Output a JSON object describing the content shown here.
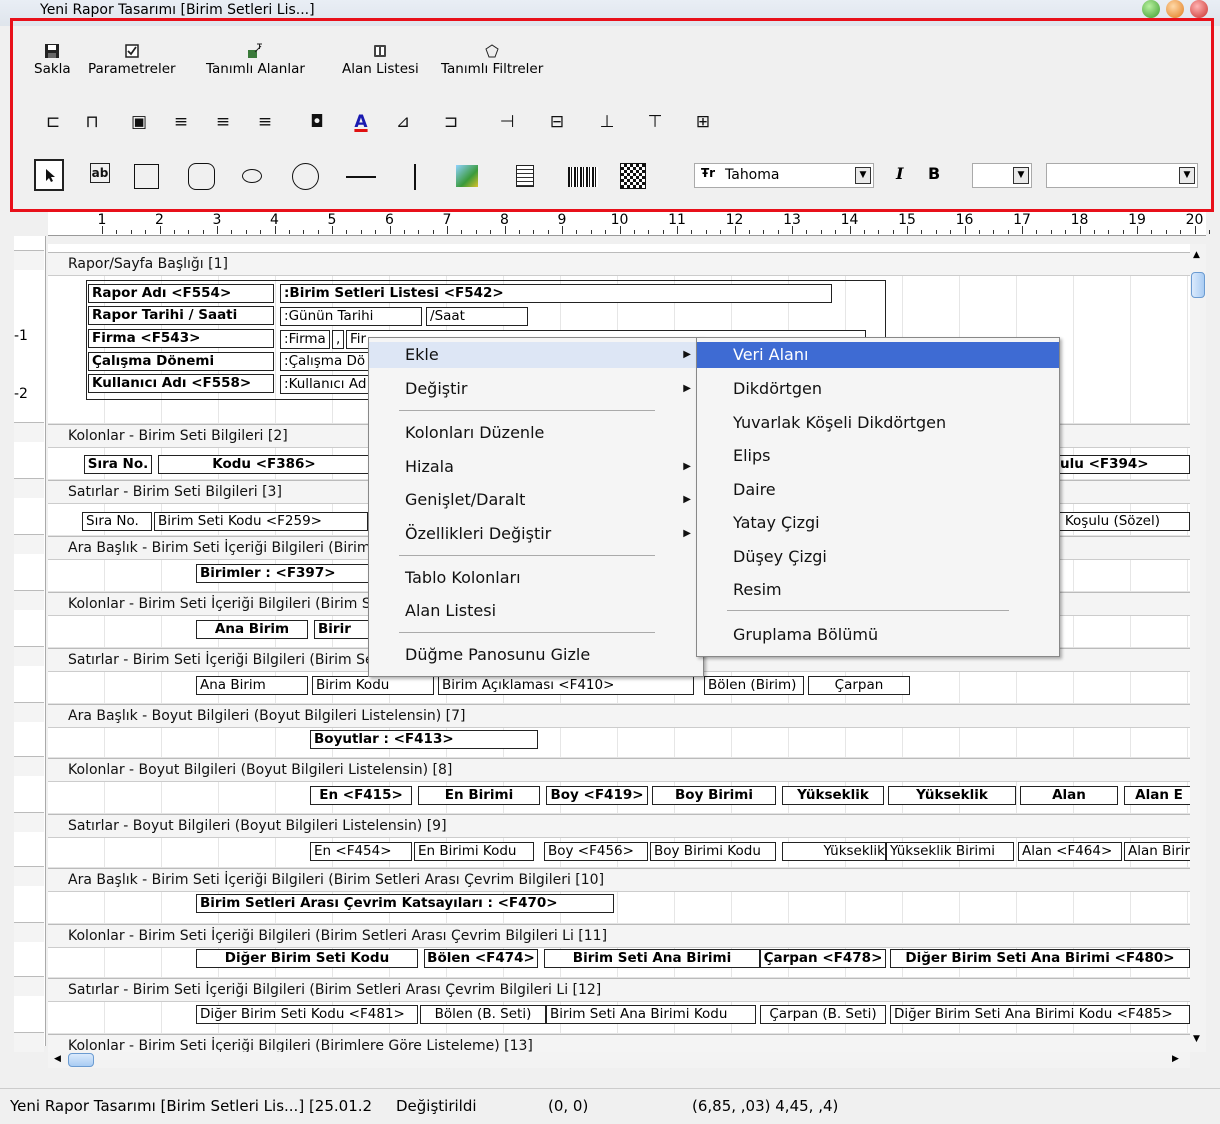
{
  "window": {
    "title": "Yeni Rapor Tasarımı [Birim Setleri Lis...]"
  },
  "toolbar": {
    "row1": [
      {
        "label": "Sakla",
        "icon": "floppy-icon"
      },
      {
        "label": "Parametreler",
        "icon": "checkbox-icon"
      },
      {
        "label": "Tanımlı Alanlar",
        "icon": "fields-icon"
      },
      {
        "label": "Alan Listesi",
        "icon": "book-icon"
      },
      {
        "label": "Tanımlı Filtreler",
        "icon": "filter-icon"
      }
    ],
    "row2_icons": [
      "align-left-edges-icon",
      "align-top-edges-icon",
      "fill-icon",
      "text-align-left-icon",
      "text-align-center-icon",
      "text-align-right-icon",
      "border-color-icon",
      "font-color-icon",
      "rotate-icon",
      "shrink-left-icon",
      "grow-right-icon",
      "equal-width-icon",
      "shrink-up-icon",
      "grow-down-icon",
      "equal-height-icon"
    ],
    "row2_font_color_glyph": "A",
    "row3_icons": [
      "pointer-icon",
      "textbox-icon",
      "rectangle-icon",
      "rounded-rectangle-icon",
      "ellipse-icon",
      "circle-icon",
      "horizontal-line-icon",
      "vertical-line-icon",
      "image-icon",
      "memo-icon",
      "barcode-icon",
      "qrcode-icon"
    ],
    "font_name": "Tahoma",
    "italic": "I",
    "bold": "B",
    "font_size": "",
    "extra_combo": ""
  },
  "ruler": {
    "numbers": [
      "1",
      "2",
      "3",
      "4",
      "5",
      "6",
      "7",
      "8",
      "9",
      "10",
      "11",
      "12",
      "13",
      "14",
      "15",
      "16",
      "17",
      "18",
      "19",
      "20"
    ]
  },
  "left_rail": {
    "labels": [
      "-1",
      "-2"
    ]
  },
  "bands": [
    "Rapor/Sayfa Başlığı [1]",
    "Kolonlar - Birim Seti Bilgileri [2]",
    "Satırlar - Birim Seti Bilgileri [3]",
    "Ara Başlık - Birim Seti İçeriği Bilgileri (Birim",
    "Kolonlar - Birim Seti İçeriği Bilgileri (Birim S",
    "Satırlar - Birim Seti İçeriği Bilgileri (Birim Se",
    "Ara Başlık - Boyut Bilgileri (Boyut Bilgileri Listelensin) [7]",
    "Kolonlar - Boyut Bilgileri (Boyut Bilgileri Listelensin) [8]",
    "Satırlar - Boyut Bilgileri (Boyut Bilgileri Listelensin) [9]",
    "Ara Başlık - Birim Seti İçeriği Bilgileri (Birim Setleri Arası Çevrim Bilgileri  [10]",
    "Kolonlar - Birim Seti İçeriği Bilgileri (Birim Setleri Arası Çevrim Bilgileri Li [11]",
    "Satırlar - Birim Seti İçeriği Bilgileri (Birim Setleri Arası Çevrim Bilgileri Li [12]",
    "Kolonlar - Birim Seti İçeriği Bilgileri (Birimlere Göre Listeleme) [13]"
  ],
  "header_cells": {
    "labels": [
      "Rapor Adı <F554>",
      "Rapor Tarihi / Saati",
      "Firma <F543>",
      "Çalışma Dönemi",
      "Kullanıcı Adı <F558>"
    ],
    "colon": ":",
    "title_value": "Birim Setleri Listesi <F542>",
    "date": "Günün Tarihi",
    "slash": "/",
    "time": "Saat",
    "firma": "Firma",
    "comma": ",",
    "firma2": "Fir",
    "donem": "Çalışma Dö",
    "kullanici": "Kullanıcı Ad"
  },
  "rows": {
    "r2": [
      "Sıra No.",
      "Kodu <F386>",
      "şulu <F394>"
    ],
    "r3": [
      "Sıra No.",
      "Birim Seti Kodu <F259>",
      "n Koşulu (Sözel)"
    ],
    "r4": [
      "Birimler : <F397>"
    ],
    "r5": [
      "Ana Birim",
      "Birir"
    ],
    "r6": [
      "Ana Birim",
      "Birim Kodu",
      "Birim Açıklaması <F410>",
      "Bölen (Birim)",
      "Çarpan"
    ],
    "r7": [
      "Boyutlar : <F413>"
    ],
    "r8": [
      "En <F415>",
      "En Birimi",
      "Boy <F419>",
      "Boy Birimi",
      "Yükseklik",
      "Yükseklik",
      "Alan",
      "Alan E"
    ],
    "r9": [
      "En <F454>",
      "En Birimi Kodu",
      "Boy <F456>",
      "Boy Birimi Kodu",
      "Yükseklik",
      "Yükseklik Birimi",
      "Alan <F464>",
      "Alan Birin"
    ],
    "r10": [
      "Birim Setleri Arası Çevrim Katsayıları : <F470>"
    ],
    "r11": [
      "Diğer Birim Seti Kodu",
      "Bölen <F474>",
      "Birim Seti Ana Birimi",
      "Çarpan <F478>",
      "Diğer Birim Seti Ana Birimi <F480>"
    ],
    "r12": [
      "Diğer Birim Seti Kodu <F481>",
      "Bölen (B. Seti)",
      "Birim Seti Ana Birimi Kodu",
      "Çarpan (B. Seti)",
      "Diğer Birim Seti Ana Birimi Kodu <F485>"
    ]
  },
  "context_menu": {
    "items": [
      "Ekle",
      "Değiştir",
      "Kolonları Düzenle",
      "Hizala",
      "Genişlet/Daralt",
      "Özellikleri Değiştir",
      "Tablo Kolonları",
      "Alan Listesi",
      "Düğme Panosunu Gizle"
    ],
    "arrow": "▶"
  },
  "submenu": {
    "items": [
      "Veri Alanı",
      "Dikdörtgen",
      "Yuvarlak Köşeli Dikdörtgen",
      "Elips",
      "Daire",
      "Yatay Çizgi",
      "Düşey Çizgi",
      "Resim",
      "Gruplama Bölümü"
    ]
  },
  "statusbar": {
    "doc": "Yeni Rapor Tasarımı [Birim Setleri Lis...] [25.01.2",
    "state": "Değiştirildi",
    "pos": "(0, 0)",
    "size": "(6,85, ,03) 4,45, ,4)"
  },
  "colors": {
    "highlight": "#3e6bd3",
    "annotation_border": "#e8101a"
  }
}
